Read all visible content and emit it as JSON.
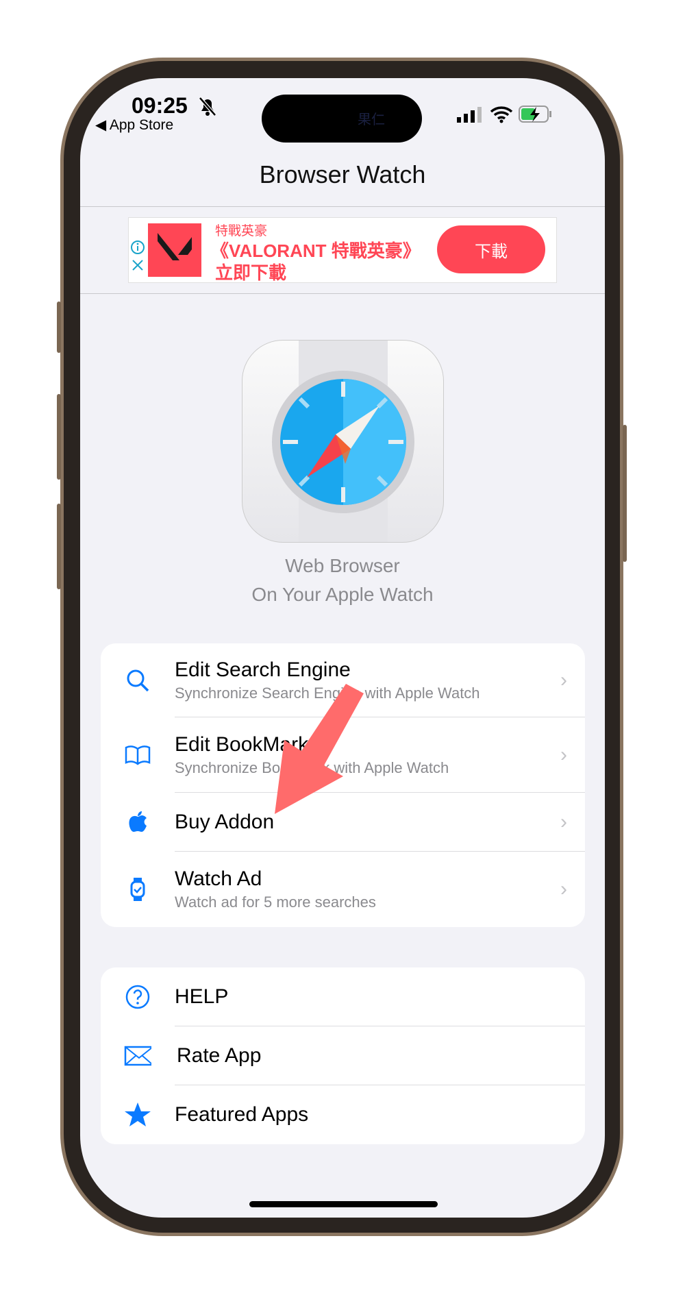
{
  "status_bar": {
    "time": "09:25",
    "back_label": "◀ App Store",
    "island_text": "果仁"
  },
  "nav": {
    "title": "Browser Watch"
  },
  "ad": {
    "brand": "特戰英豪",
    "headline": "《VALORANT 特戰英豪》",
    "headline2": "立即下載",
    "cta": "下載",
    "accent": "#ff4655"
  },
  "app": {
    "tagline1": "Web Browser",
    "tagline2": "On Your Apple Watch"
  },
  "menu1": [
    {
      "icon": "search-icon",
      "title": "Edit Search Engine",
      "subtitle": "Synchronize Search Engine with Apple Watch"
    },
    {
      "icon": "book-icon",
      "title": "Edit BookMark",
      "subtitle": "Synchronize BookMark with Apple Watch"
    },
    {
      "icon": "apple-icon",
      "title": "Buy Addon",
      "subtitle": ""
    },
    {
      "icon": "watch-icon",
      "title": "Watch Ad",
      "subtitle": "Watch ad for 5 more searches"
    }
  ],
  "menu2": [
    {
      "icon": "help-icon",
      "title": "HELP"
    },
    {
      "icon": "mail-icon",
      "title": "Rate App"
    },
    {
      "icon": "star-icon",
      "title": "Featured Apps"
    }
  ],
  "colors": {
    "accent": "#0a7aff",
    "annotation_arrow": "#ff6b6b"
  }
}
